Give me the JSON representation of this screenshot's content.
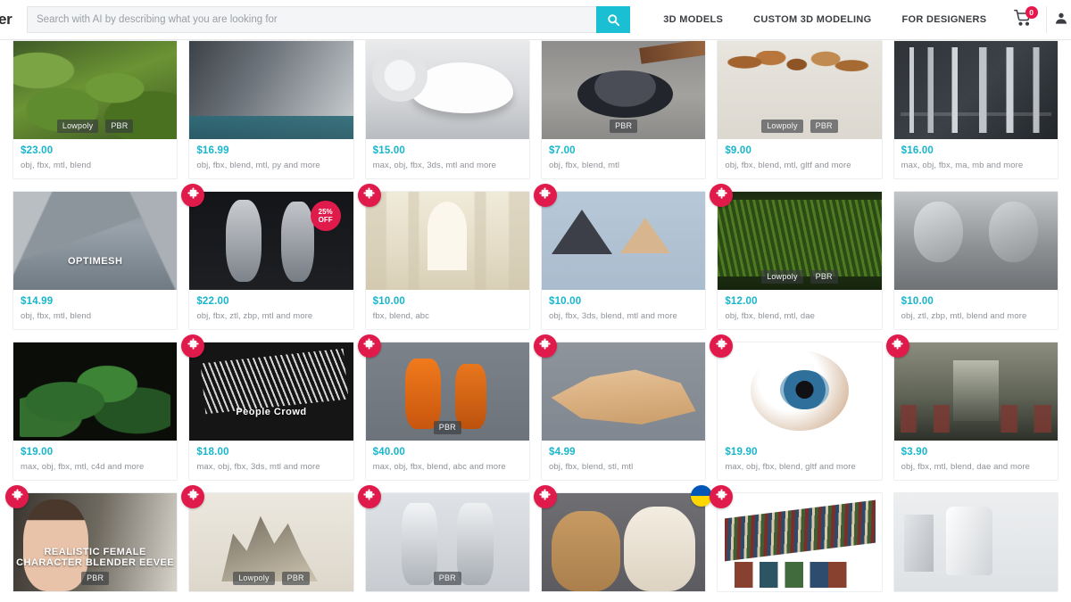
{
  "header": {
    "brand_text": "er",
    "search": {
      "placeholder": "Search with AI by describing what you are looking for",
      "value": "",
      "icon": "search-icon",
      "button_color": "#1bbfd4"
    },
    "nav": [
      {
        "label": "3D MODELS"
      },
      {
        "label": "CUSTOM 3D MODELING"
      },
      {
        "label": "FOR DESIGNERS"
      }
    ],
    "cart": {
      "icon": "cart-icon",
      "count": "0",
      "badge_color": "#e8174b"
    },
    "user": {
      "icon": "user-icon"
    }
  },
  "colors": {
    "price": "#17b6cc",
    "favorite_badge": "#e01b4c",
    "tag_bg": "rgba(55,58,62,.62)"
  },
  "grid": {
    "columns": 6,
    "cards": [
      {
        "price": "$23.00",
        "formats": "obj, fbx, mtl, blend",
        "tags": [
          "Lowpoly",
          "PBR"
        ],
        "favorite": false,
        "art": "a-moss",
        "caption": ""
      },
      {
        "price": "$16.99",
        "formats": "obj, fbx, blend, mtl, py and more",
        "tags": [],
        "favorite": false,
        "art": "a-figs",
        "caption": ""
      },
      {
        "price": "$15.00",
        "formats": "max, obj, fbx, 3ds, mtl and more",
        "tags": [],
        "favorite": false,
        "art": "a-shoe",
        "caption": ""
      },
      {
        "price": "$7.00",
        "formats": "obj, fbx, blend, mtl",
        "tags": [
          "PBR"
        ],
        "favorite": false,
        "art": "a-ash",
        "caption": ""
      },
      {
        "price": "$9.00",
        "formats": "obj, fbx, blend, mtl, gltf and more",
        "tags": [
          "Lowpoly",
          "PBR"
        ],
        "favorite": false,
        "art": "a-mush",
        "caption": ""
      },
      {
        "price": "$16.00",
        "formats": "max, obj, fbx, ma, mb and more",
        "tags": [],
        "favorite": false,
        "art": "a-mech",
        "caption": ""
      },
      {
        "price": "$14.99",
        "formats": "obj, fbx, mtl, blend",
        "tags": [],
        "favorite": false,
        "art": "a-rock",
        "caption": "OPTIMESH"
      },
      {
        "price": "$22.00",
        "formats": "obj, fbx, ztl, zbp, mtl and more",
        "tags": [],
        "favorite": true,
        "art": "a-anat",
        "caption": "",
        "discount": "25% OFF"
      },
      {
        "price": "$10.00",
        "formats": "fbx, blend, abc",
        "tags": [],
        "favorite": true,
        "art": "a-hall",
        "caption": ""
      },
      {
        "price": "$10.00",
        "formats": "obj, fbx, 3ds, blend, mtl and more",
        "tags": [],
        "favorite": true,
        "art": "a-pyr",
        "caption": ""
      },
      {
        "price": "$12.00",
        "formats": "obj, fbx, blend, mtl, dae",
        "tags": [
          "Lowpoly",
          "PBR"
        ],
        "favorite": true,
        "art": "a-corn",
        "caption": ""
      },
      {
        "price": "$10.00",
        "formats": "obj, ztl, zbp, mtl, blend and more",
        "tags": [],
        "favorite": false,
        "art": "a-head",
        "caption": ""
      },
      {
        "price": "$19.00",
        "formats": "max, obj, fbx, mtl, c4d and more",
        "tags": [],
        "favorite": false,
        "art": "a-plant",
        "caption": ""
      },
      {
        "price": "$18.00",
        "formats": "max, obj, fbx, 3ds, mtl and more",
        "tags": [],
        "favorite": true,
        "art": "a-crowd",
        "caption": "People Crowd"
      },
      {
        "price": "$40.00",
        "formats": "max, obj, fbx, blend, abc and more",
        "tags": [
          "PBR"
        ],
        "favorite": true,
        "art": "a-astro",
        "caption": ""
      },
      {
        "price": "$4.99",
        "formats": "obj, fbx, blend, stl, mtl",
        "tags": [],
        "favorite": true,
        "art": "a-dune",
        "caption": ""
      },
      {
        "price": "$19.90",
        "formats": "max, obj, fbx, blend, gltf and more",
        "tags": [],
        "favorite": true,
        "art": "a-eye",
        "caption": ""
      },
      {
        "price": "$3.90",
        "formats": "obj, fbx, mtl, blend, dae and more",
        "tags": [],
        "favorite": true,
        "art": "a-train",
        "caption": ""
      },
      {
        "price": "",
        "formats": "",
        "tags": [
          "PBR"
        ],
        "favorite": true,
        "art": "a-female",
        "caption": "REALISTIC FEMALE CHARACTER BLENDER EEVEE"
      },
      {
        "price": "",
        "formats": "",
        "tags": [
          "Lowpoly",
          "PBR"
        ],
        "favorite": true,
        "art": "a-cryst",
        "caption": ""
      },
      {
        "price": "",
        "formats": "",
        "tags": [
          "PBR"
        ],
        "favorite": true,
        "art": "a-spacesuit",
        "caption": ""
      },
      {
        "price": "",
        "formats": "",
        "tags": [],
        "favorite": true,
        "art": "a-teddy",
        "caption": "",
        "flag": "ukraine-flag"
      },
      {
        "price": "",
        "formats": "",
        "tags": [],
        "favorite": true,
        "art": "a-books",
        "caption": ""
      },
      {
        "price": "",
        "formats": "",
        "tags": [],
        "favorite": false,
        "art": "a-pouch",
        "caption": ""
      }
    ]
  }
}
